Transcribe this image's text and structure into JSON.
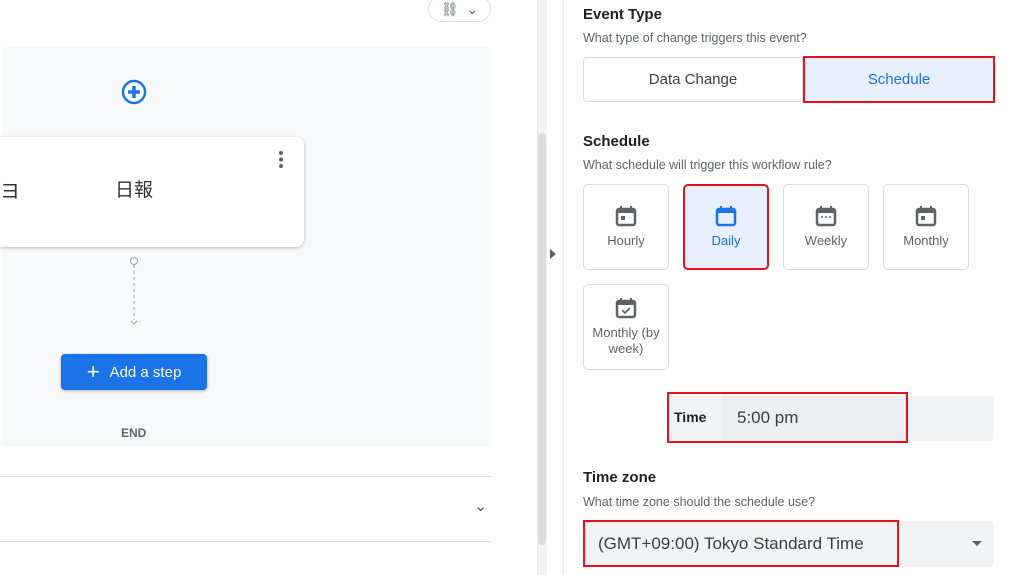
{
  "canvas": {
    "step_title": "日報",
    "step_icon_partial": "ヨ",
    "add_step_label": "Add a step",
    "end_label": "END"
  },
  "event_type": {
    "heading": "Event Type",
    "description": "What type of change triggers this event?",
    "options": [
      "Data Change",
      "Schedule"
    ],
    "selected": "Schedule"
  },
  "schedule": {
    "heading": "Schedule",
    "description": "What schedule will trigger this workflow rule?",
    "options": [
      {
        "label": "Hourly",
        "icon": "calendar-dot-icon"
      },
      {
        "label": "Daily",
        "icon": "calendar-icon"
      },
      {
        "label": "Weekly",
        "icon": "calendar-week-icon"
      },
      {
        "label": "Monthly",
        "icon": "calendar-dot-icon"
      },
      {
        "label": "Monthly (by week)",
        "icon": "calendar-check-icon"
      }
    ],
    "selected": "Daily"
  },
  "time": {
    "label": "Time",
    "value": "5:00 pm"
  },
  "timezone": {
    "heading": "Time zone",
    "description": "What time zone should the schedule use?",
    "value": "(GMT+09:00) Tokyo Standard Time"
  },
  "colors": {
    "accent": "#1a73e8",
    "highlight": "#e8101a",
    "selected_bg": "#e8f0fe"
  }
}
